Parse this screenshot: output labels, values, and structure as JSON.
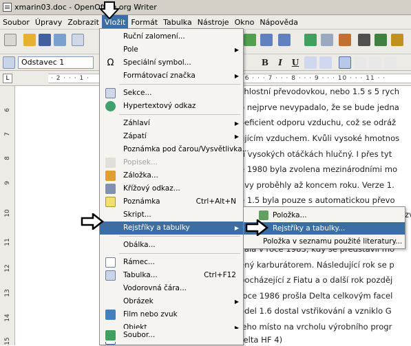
{
  "window": {
    "title": "xmarin03.doc - OpenOffice.org Writer"
  },
  "menubar": {
    "items": [
      "Soubor",
      "Úpravy",
      "Zobrazit",
      "Vložit",
      "Formát",
      "Tabulka",
      "Nástroje",
      "Okno",
      "Nápověda"
    ],
    "active": "Vložit"
  },
  "formatting": {
    "paragraph_style": "Odstavec 1",
    "bold": "B",
    "italic": "I",
    "underline": "U"
  },
  "ruler": {
    "h_marks": "· 2 · · · 1 ·",
    "h_marks_right": "· 6 · · · 7 · · · 8 · · · 9 · · · 10 · · · 11 · ·",
    "v_marks": [
      "6",
      "7",
      "8",
      "9",
      "10",
      "11",
      "12",
      "13",
      "14",
      "15"
    ]
  },
  "insert_menu": {
    "items": [
      {
        "label": "Ruční zalomení...",
        "icon": "none"
      },
      {
        "label": "Pole",
        "submenu": true
      },
      {
        "label": "Speciální symbol...",
        "icon": "omega-icon"
      },
      {
        "label": "Formátovací značka",
        "submenu": true
      },
      {
        "label": "Sekce...",
        "icon": "section-icon"
      },
      {
        "label": "Hypertextový odkaz",
        "icon": "hyperlink-icon"
      },
      {
        "label": "Záhlaví",
        "submenu": true
      },
      {
        "label": "Zápatí",
        "submenu": true
      },
      {
        "label": "Poznámka pod čarou/Vysvětlivka..."
      },
      {
        "label": "Popisek...",
        "disabled": true,
        "icon": "caption-icon"
      },
      {
        "label": "Záložka...",
        "icon": "bookmark-icon"
      },
      {
        "label": "Křížový odkaz...",
        "icon": "crossref-icon"
      },
      {
        "label": "Poznámka",
        "shortcut": "Ctrl+Alt+N",
        "icon": "note-icon"
      },
      {
        "label": "Skript..."
      },
      {
        "label": "Rejstříky a tabulky",
        "submenu": true,
        "highlighted": true
      },
      {
        "label": "Obálka..."
      },
      {
        "label": "Rámec...",
        "icon": "frame-icon"
      },
      {
        "label": "Tabulka...",
        "shortcut": "Ctrl+F12",
        "icon": "table-icon"
      },
      {
        "label": "Vodorovná čára..."
      },
      {
        "label": "Obrázek",
        "submenu": true
      },
      {
        "label": "Film nebo zvuk",
        "icon": "film-icon"
      },
      {
        "label": "Objekt",
        "submenu": true
      },
      {
        "label": "Plovoucí rámec",
        "icon": "floating-frame-icon"
      },
      {
        "label": "Soubor...",
        "icon": "file-icon"
      }
    ]
  },
  "index_submenu": {
    "items": [
      {
        "label": "Položka...",
        "icon": "entry-icon"
      },
      {
        "label": "Rejstříky a tabulky...",
        "highlighted": true
      },
      {
        "label": "Položka v seznamu použité literatury..."
      }
    ]
  },
  "document": {
    "lines": [
      "chlostní převodovkou, nebo 1.5 s 5 rych",
      "o nejprve nevypadalo, že se bude jedna",
      "oeficient odporu vzduchu, což se odráž",
      "ujícím vzduchem. Kvůli vysoké hmotnos",
      "ři vysokých otáčkách hlučný. I přes tyt",
      "e 1980 byla zvolena mezinárodními mo",
      "avy proběhly až koncem roku. Verze 1.",
      "e 1.5 byla pouze s automatickou převo",
      "zv",
      "",
      "vala v roce 1983, kdy se představil mo",
      "ený karburátorem. Následující rok se p",
      "pocházející z Fiatu a o další rok pozděj",
      "roce 1986 prošla Delta celkovým facel",
      "odel 1.6 dostal vstřikování a vzniklo G",
      "jeho místo na vrcholu výrobního progr"
    ],
    "bottom_line": "Delta HF 4WD(viz. Obrázek 1 Delta HF 4)"
  }
}
